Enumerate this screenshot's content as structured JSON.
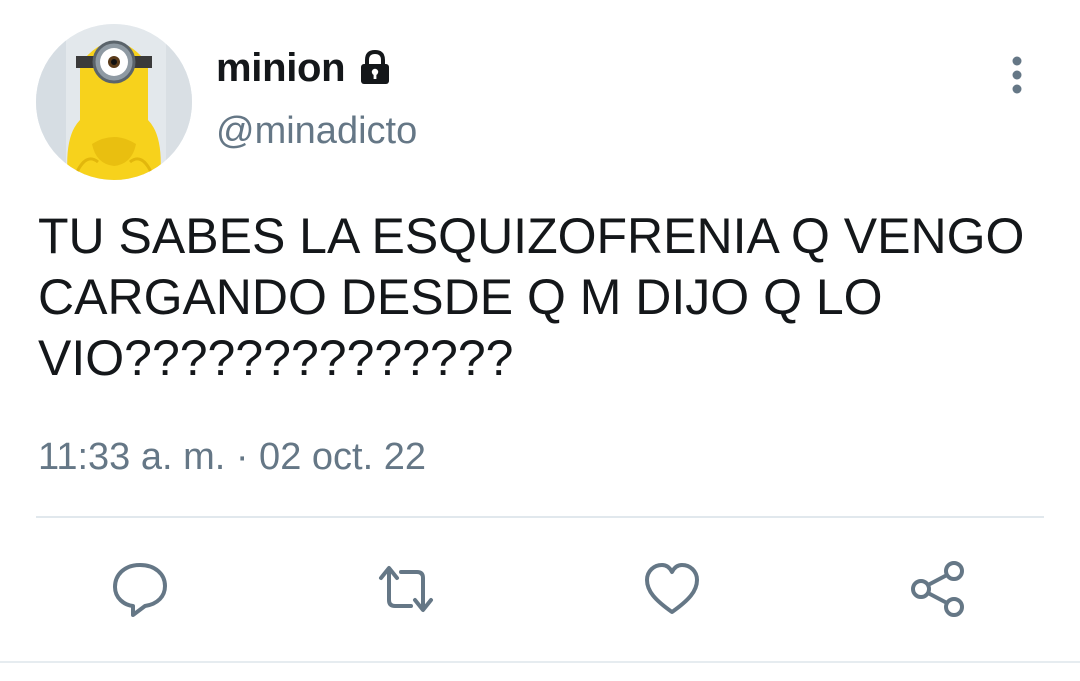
{
  "tweet": {
    "author": {
      "display_name": "minion",
      "handle": "@minadicto",
      "protected": true,
      "avatar_icon": "minion-avatar"
    },
    "text": "TU SABES LA ESQUIZOFRENIA Q VENGO CARGANDO DESDE Q M DIJO Q LO VIO??????????????",
    "timestamp": "11:33 a. m. · 02 oct. 22"
  },
  "actions": [
    {
      "name": "reply",
      "icon": "reply-icon"
    },
    {
      "name": "retweet",
      "icon": "retweet-icon"
    },
    {
      "name": "like",
      "icon": "heart-icon"
    },
    {
      "name": "share",
      "icon": "share-icon"
    }
  ],
  "colors": {
    "text": "#14171a",
    "secondary": "#657786",
    "divider": "#e1e8ed",
    "avatar_yellow": "#f7d21c"
  }
}
